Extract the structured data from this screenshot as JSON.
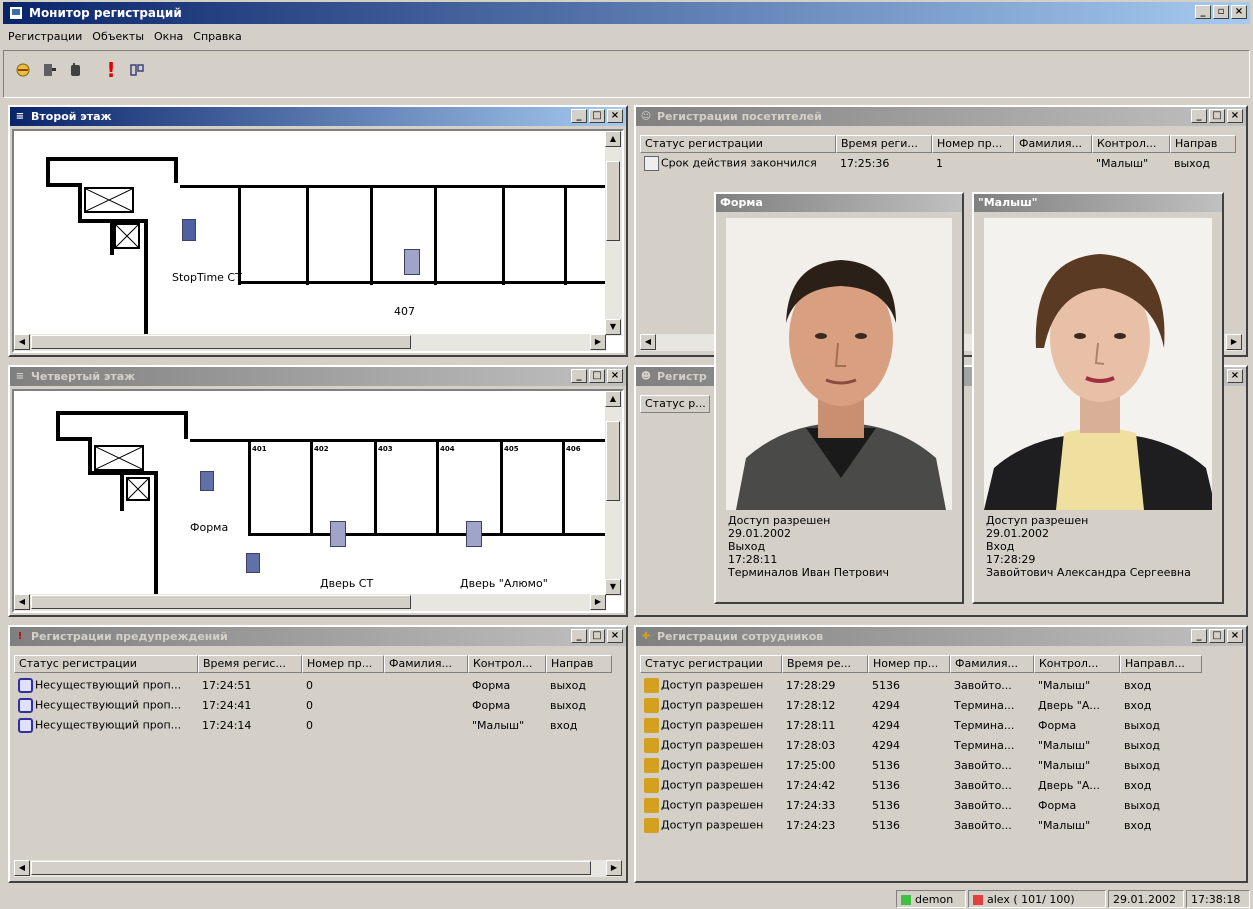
{
  "app": {
    "title": "Монитор регистраций"
  },
  "menu": [
    "Регистрации",
    "Объекты",
    "Окна",
    "Справка"
  ],
  "floor2": {
    "title": "Второй этаж",
    "labels": {
      "device": "StopTime CT",
      "room": "407"
    }
  },
  "floor4": {
    "title": "Четвертый этаж",
    "rooms": [
      "401",
      "402",
      "403",
      "404",
      "405",
      "406"
    ],
    "labels": {
      "forma": "Форма",
      "door_ct": "Дверь СТ",
      "door_alumo": "Дверь \"Алюмо\""
    }
  },
  "visitors": {
    "title": "Регистрации посетителей",
    "columns": [
      "Статус регистрации",
      "Время реги...",
      "Номер пр...",
      "Фамилия...",
      "Контрол...",
      "Направ"
    ],
    "rows": [
      [
        "Срок действия закончился",
        "17:25:36",
        "1",
        "",
        "\"Малыш\"",
        "выход"
      ]
    ]
  },
  "hidden_win": {
    "title": "Регистр",
    "column": "Статус р..."
  },
  "photo1": {
    "title": "Форма",
    "status": "Доступ разрешен",
    "date": "29.01.2002",
    "direction": "Выход",
    "time": "17:28:11",
    "name": "Терминалов Иван Петрович"
  },
  "photo2": {
    "title": "\"Малыш\"",
    "status": "Доступ разрешен",
    "date": "29.01.2002",
    "direction": "Вход",
    "time": "17:28:29",
    "name": "Завойтович Александра Сергеевна"
  },
  "warnings": {
    "title": "Регистрации предупреждений",
    "columns": [
      "Статус регистрации",
      "Время регис...",
      "Номер пр...",
      "Фамилия...",
      "Контрол...",
      "Направ"
    ],
    "rows": [
      [
        "Несуществующий проп...",
        "17:24:51",
        "0",
        "",
        "Форма",
        "выход"
      ],
      [
        "Несуществующий проп...",
        "17:24:41",
        "0",
        "",
        "Форма",
        "выход"
      ],
      [
        "Несуществующий проп...",
        "17:24:14",
        "0",
        "",
        "\"Малыш\"",
        "вход"
      ]
    ]
  },
  "employees": {
    "title": "Регистрации сотрудников",
    "columns": [
      "Статус регистрации",
      "Время ре...",
      "Номер пр...",
      "Фамилия...",
      "Контрол...",
      "Направл..."
    ],
    "rows": [
      [
        "Доступ разрешен",
        "17:28:29",
        "5136",
        "Завойто...",
        "\"Малыш\"",
        "вход"
      ],
      [
        "Доступ разрешен",
        "17:28:12",
        "4294",
        "Термина...",
        "Дверь \"А...",
        "вход"
      ],
      [
        "Доступ разрешен",
        "17:28:11",
        "4294",
        "Термина...",
        "Форма",
        "выход"
      ],
      [
        "Доступ разрешен",
        "17:28:03",
        "4294",
        "Термина...",
        "\"Малыш\"",
        "выход"
      ],
      [
        "Доступ разрешен",
        "17:25:00",
        "5136",
        "Завойто...",
        "\"Малыш\"",
        "выход"
      ],
      [
        "Доступ разрешен",
        "17:24:42",
        "5136",
        "Завойто...",
        "Дверь \"А...",
        "вход"
      ],
      [
        "Доступ разрешен",
        "17:24:33",
        "5136",
        "Завойто...",
        "Форма",
        "выход"
      ],
      [
        "Доступ разрешен",
        "17:24:23",
        "5136",
        "Завойто...",
        "\"Малыш\"",
        "вход"
      ]
    ]
  },
  "status": {
    "user1": "demon",
    "user2": "alex ( 101/ 100)",
    "date": "29.01.2002",
    "time": "17:38:18"
  },
  "colors": {
    "active_title": "#0a246a",
    "inactive_title": "#808080",
    "ok_icon": "#d4a020",
    "warn_icon": "#cc0000"
  }
}
